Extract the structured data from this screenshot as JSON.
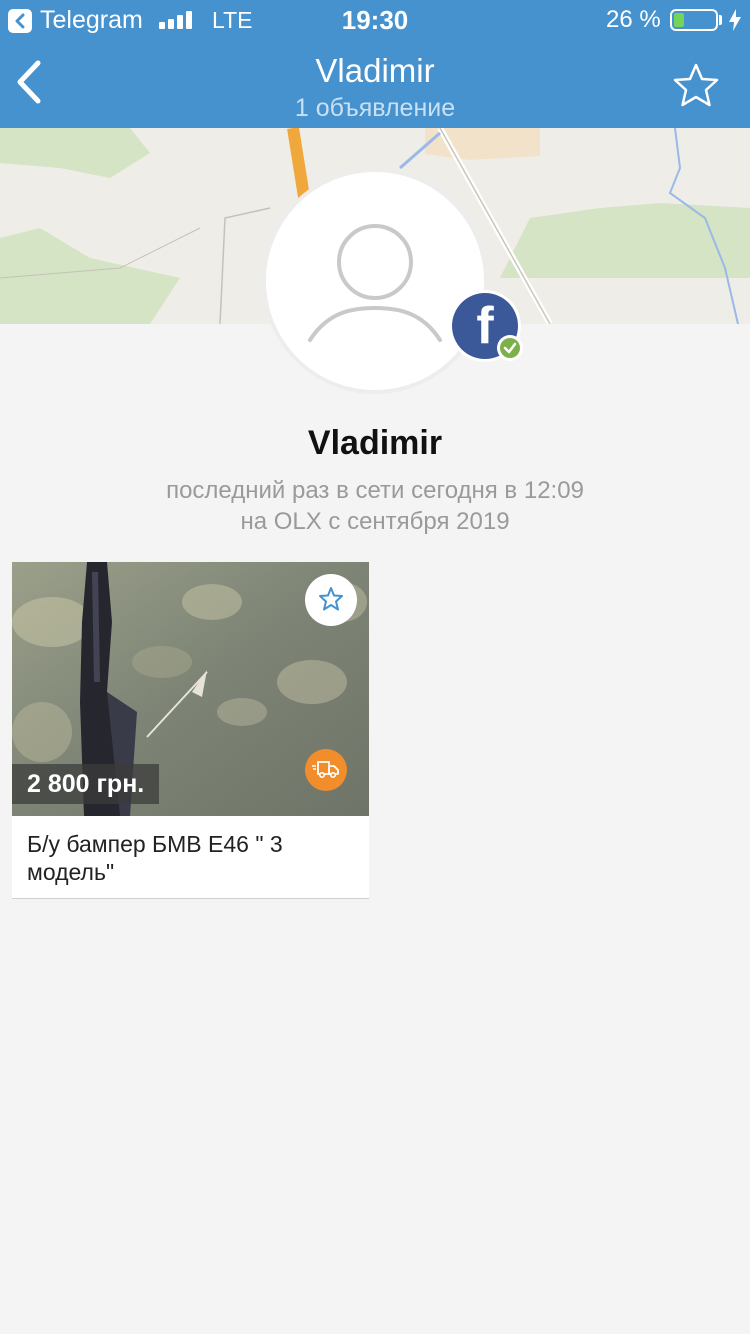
{
  "status_bar": {
    "app_name": "Telegram",
    "network": "LTE",
    "time": "19:30",
    "battery_percent_text": "26 %",
    "battery_level": 0.26,
    "battery_color": "#74d35a"
  },
  "nav": {
    "title": "Vladimir",
    "subtitle": "1 объявление",
    "back_icon": "chevron-left-icon",
    "favorite_icon": "star-outline-icon",
    "bar_color": "#4592cf"
  },
  "profile": {
    "name": "Vladimir",
    "last_seen": "последний раз в сети сегодня в 12:09",
    "member_since": "на OLX с сентября 2019",
    "avatar_icon": "user-placeholder-icon",
    "social_badge_icon": "facebook-icon",
    "verified_icon": "check-icon",
    "facebook_letter": "f"
  },
  "listings": [
    {
      "price": "2 800 грн.",
      "title": "Б/у бампер БМВ Е46 \" 3 модель\"",
      "favorite_icon": "star-outline-icon",
      "delivery_icon": "delivery-truck-icon",
      "delivery_color": "#f28d2b"
    }
  ]
}
